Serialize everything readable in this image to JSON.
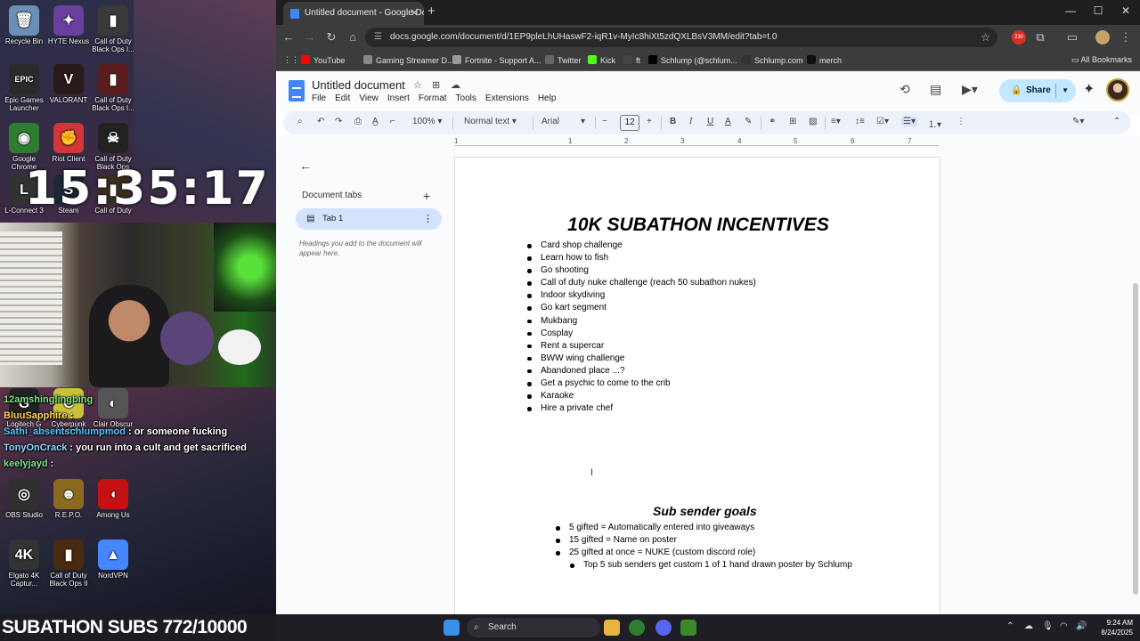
{
  "desktop": {
    "icons": [
      {
        "label": "Recycle Bin",
        "glyph": "🗑",
        "color": "#6b8fb5"
      },
      {
        "label": "HYTE Nexus",
        "glyph": "✦",
        "color": "#6a3fa0"
      },
      {
        "label": "Call of Duty Black Ops I...",
        "glyph": "▮",
        "color": "#3a3a3a"
      },
      {
        "label": "Epic Games Launcher",
        "glyph": "EPIC",
        "color": "#2a2a2a"
      },
      {
        "label": "VALORANT",
        "glyph": "V",
        "color": "#2a1a1a"
      },
      {
        "label": "Call of Duty Black Ops I...",
        "glyph": "▮",
        "color": "#5a1e1e"
      },
      {
        "label": "Google Chrome",
        "glyph": "◉",
        "color": "#2f7d32"
      },
      {
        "label": "Riot Client",
        "glyph": "✊",
        "color": "#d13639"
      },
      {
        "label": "Call of Duty Black Ops",
        "glyph": "☠",
        "color": "#222"
      },
      {
        "label": "L-Connect 3",
        "glyph": "L",
        "color": "#333"
      },
      {
        "label": "Steam",
        "glyph": "S",
        "color": "#1b2838"
      },
      {
        "label": "Call of Duty",
        "glyph": "▮",
        "color": "#3a3020"
      },
      {
        "label": "Logitech G",
        "glyph": "G",
        "color": "#222"
      },
      {
        "label": "Cyberpunk 2077",
        "glyph": "C",
        "color": "#c8c23a"
      },
      {
        "label": "Clair Obscur",
        "glyph": "◐",
        "color": "#555"
      },
      {
        "label": "OBS Studio",
        "glyph": "◎",
        "color": "#303030"
      },
      {
        "label": "R.E.P.O.",
        "glyph": "☻",
        "color": "#8a6a20"
      },
      {
        "label": "Among Us",
        "glyph": "◖",
        "color": "#c51111"
      },
      {
        "label": "Elgato 4K Captur...",
        "glyph": "4K",
        "color": "#333"
      },
      {
        "label": "Call of Duty Black Ops II",
        "glyph": "▮",
        "color": "#4a2a10"
      },
      {
        "label": "NordVPN",
        "glyph": "▲",
        "color": "#4687ff"
      }
    ],
    "clock": "15:35:17"
  },
  "chat": [
    {
      "user": "12amshinglingbing",
      "text": "",
      "color": "user"
    },
    {
      "user": "BluuSapphire",
      "text": ":",
      "color": "user2"
    },
    {
      "user": "Sathi_absentschlumpmod",
      "text": ": or someone fucking",
      "color": "user3"
    },
    {
      "user": "TonyOnCrack",
      "text": ": you run into a cult and get sacrificed",
      "color": "user4"
    },
    {
      "user": "keelyjayd",
      "text": ":",
      "color": "user"
    }
  ],
  "subathon": "SUBATHON SUBS 772/10000",
  "browser": {
    "tab_title": "Untitled document - Google Docs",
    "url": "docs.google.com/document/d/1EP9pleLhUHaswF2-iqR1v-MyIc8hiXt5zdQXLBsV3MM/edit?tab=t.0",
    "extension_badge": "230",
    "bookmarks": [
      {
        "label": "YouTube",
        "color": "#ff0000"
      },
      {
        "label": "Gaming Streamer D...",
        "color": "#888"
      },
      {
        "label": "Fortnite - Support A...",
        "color": "#999"
      },
      {
        "label": "Twitter",
        "color": "#666"
      },
      {
        "label": "Kick",
        "color": "#53fc18"
      },
      {
        "label": "ft",
        "color": "#444"
      },
      {
        "label": "Schlump (@schlum...",
        "color": "#000"
      },
      {
        "label": "Schlump.com",
        "color": "#333"
      },
      {
        "label": "merch",
        "color": "#111"
      }
    ],
    "all_bookmarks": "All Bookmarks"
  },
  "docs": {
    "title": "Untitled document",
    "menus": [
      "File",
      "Edit",
      "View",
      "Insert",
      "Format",
      "Tools",
      "Extensions",
      "Help"
    ],
    "share_label": "Share",
    "toolbar": {
      "zoom": "100%",
      "style": "Normal text",
      "font": "Arial",
      "size": "12"
    },
    "ruler_marks": [
      "1",
      "1",
      "2",
      "3",
      "4",
      "5",
      "6",
      "7"
    ],
    "tabs_panel": {
      "heading": "Document tabs",
      "tab": "Tab 1",
      "hint": "Headings you add to the document will appear here."
    },
    "heading1": "10K SUBATHON INCENTIVES",
    "incentives": [
      "Card shop challenge",
      "Learn how to fish",
      "Go shooting",
      "Call of duty nuke challenge (reach 50 subathon nukes)",
      "Indoor skydiving",
      "Go kart segment",
      "Mukbang",
      "Cosplay",
      "Rent a supercar",
      "BWW  wing challenge",
      "Abandoned place ...?",
      "Get a psychic to come to the crib",
      "Karaoke",
      "Hire a private chef"
    ],
    "heading2": "Sub sender goals",
    "goals": [
      "5 gifted = Automatically entered into giveaways",
      "15 gifted = Name on poster",
      "25 gifted at once = NUKE (custom discord role)"
    ],
    "subgoals": [
      "Top 5 sub senders get custom 1 of 1 hand drawn poster by Schlump"
    ]
  },
  "taskbar": {
    "search": "Search",
    "time": "9:24 AM",
    "date": "8/24/2025"
  }
}
